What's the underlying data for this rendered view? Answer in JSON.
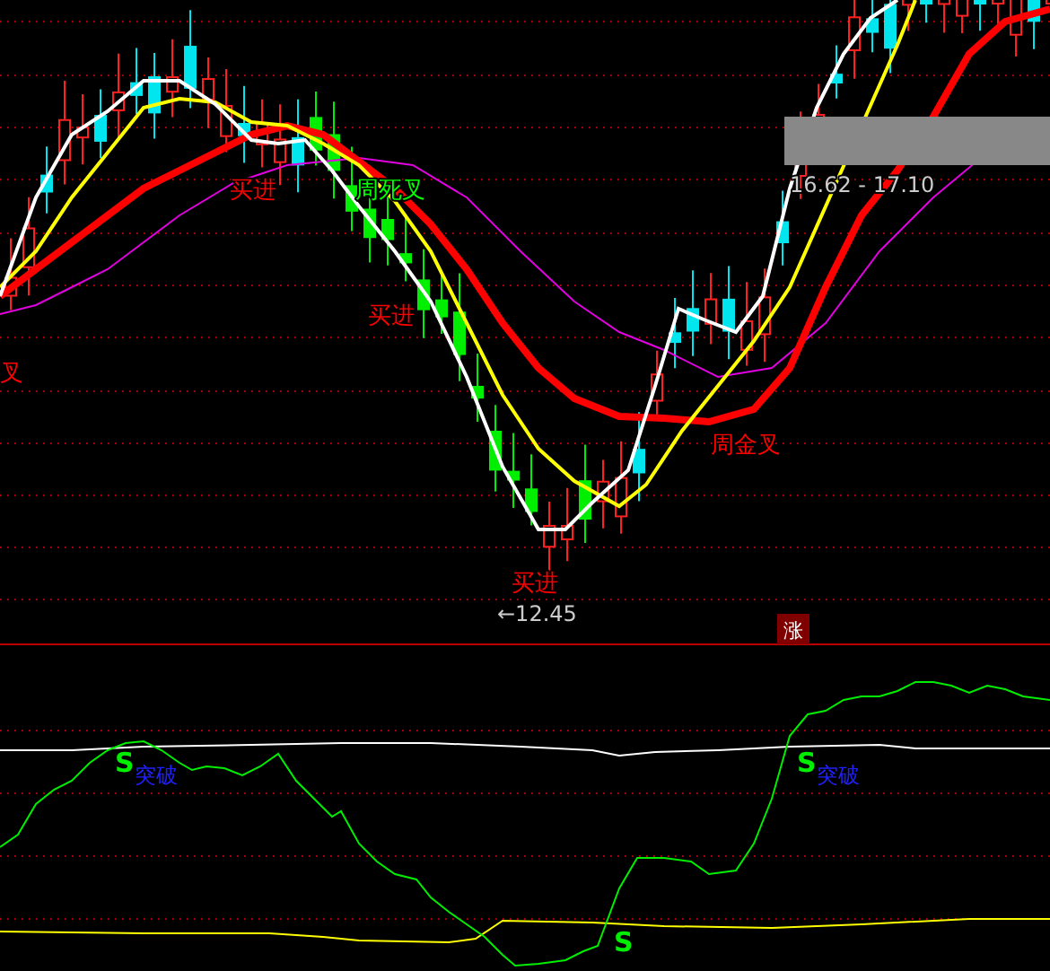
{
  "price_panel": {
    "signals": [
      {
        "text": "买进",
        "color": "#ff0000"
      },
      {
        "text": "周死叉",
        "color": "#00ff00"
      },
      {
        "text": "买进",
        "color": "#ff0000"
      },
      {
        "text": "叉",
        "color": "#ff0000"
      },
      {
        "text": "周金叉",
        "color": "#ff0000"
      },
      {
        "text": "买进",
        "color": "#ff0000"
      }
    ],
    "price_range": "16.62 - 17.10",
    "low_price": "←12.45",
    "badge": "涨"
  },
  "indicator_panel": {
    "signals": [
      {
        "mark": "S",
        "text": "突破"
      },
      {
        "mark": "S",
        "text": "突破"
      },
      {
        "mark": "S"
      }
    ]
  }
}
